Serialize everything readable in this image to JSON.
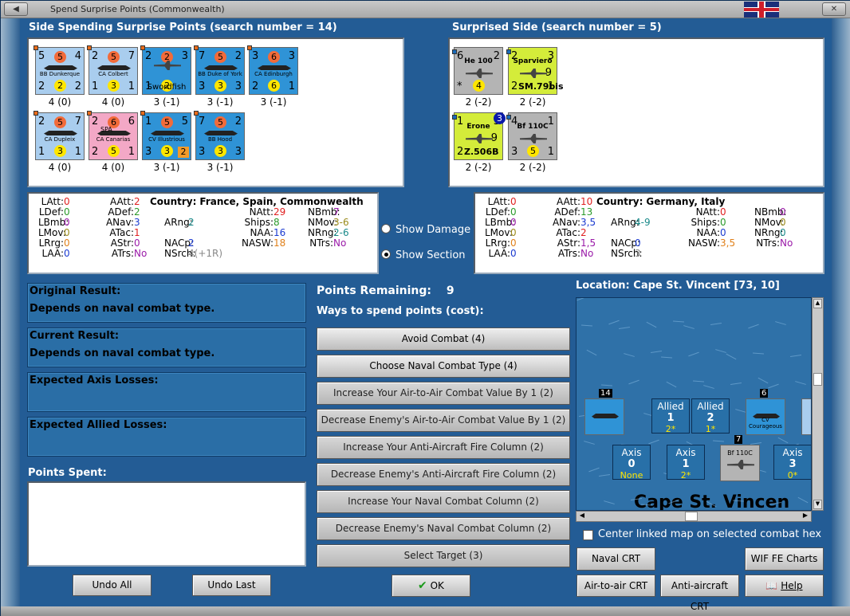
{
  "window": {
    "title": "Spend Surprise Points (Commonwealth)"
  },
  "spending": {
    "header": "Side Spending Surprise Points (search number = 14)",
    "units": [
      {
        "name": "BB Dunkerque",
        "tl": "5",
        "red": "5",
        "tr": "4",
        "bl": "2",
        "yel": "2",
        "br": "2",
        "cap": "4 (0)",
        "color": "#a9cdee",
        "kind": "ship"
      },
      {
        "name": "CA Colbert",
        "tl": "2",
        "red": "5",
        "tr": "7",
        "bl": "1",
        "yel": "3",
        "br": "1",
        "cap": "4 (0)",
        "color": "#a9cdee",
        "kind": "ship"
      },
      {
        "name": "Swordfish",
        "tl": "2",
        "red": "2",
        "tr": "3",
        "bl": "1",
        "yel": "2",
        "br": "",
        "cap": "3 (-1)",
        "color": "#2f93d6",
        "kind": "plane"
      },
      {
        "name": "BB Duke of York",
        "tl": "7",
        "red": "5",
        "tr": "2",
        "bl": "3",
        "yel": "3",
        "br": "3",
        "cap": "3 (-1)",
        "color": "#2f93d6",
        "kind": "ship"
      },
      {
        "name": "CA Edinburgh",
        "tl": "3",
        "red": "6",
        "tr": "3",
        "bl": "2",
        "yel": "6",
        "br": "1",
        "cap": "3 (-1)",
        "color": "#2f93d6",
        "kind": "ship"
      },
      {
        "name": "CA Dupleix",
        "tl": "2",
        "red": "5",
        "tr": "7",
        "bl": "1",
        "yel": "3",
        "br": "1",
        "cap": "4 (0)",
        "color": "#a9cdee",
        "kind": "ship"
      },
      {
        "name": "CA Canarias",
        "tl": "2",
        "red": "6",
        "tr": "6",
        "bl": "2",
        "yel": "5",
        "br": "1",
        "cap": "4 (0)",
        "color": "#f3a8c6",
        "kind": "ship"
      },
      {
        "name": "CV Illustrious",
        "tl": "1",
        "red": "5",
        "tr": "5",
        "bl": "3",
        "yel": "3",
        "br": "2",
        "cap": "3 (-1)",
        "color": "#2f93d6",
        "kind": "ship"
      },
      {
        "name": "BB Hood",
        "tl": "7",
        "red": "5",
        "tr": "2",
        "bl": "3",
        "yel": "3",
        "br": "3",
        "cap": "3 (-1)",
        "color": "#2f93d6",
        "kind": "ship"
      }
    ],
    "spa_label": "SPA"
  },
  "surprised": {
    "header": "Surprised Side (search number = 5)",
    "units": [
      {
        "name": "He 100",
        "tl": "6",
        "tr": "2",
        "bl": "*",
        "yel": "4",
        "br": "",
        "cap": "2 (-2)",
        "color": "#b4b4b4"
      },
      {
        "name": "Sparviero",
        "tl": "2",
        "tr": "3",
        "bl": "2",
        "yel": "",
        "br": "1",
        "extra": "9",
        "sub": "SM.79bis",
        "cap": "2 (-2)",
        "color": "#d4ec3a"
      },
      {
        "name": "Erone",
        "tl": "1",
        "tr": "3",
        "bl": "2",
        "yel": "",
        "br": "",
        "extra": "9",
        "sub": "Z.506B",
        "cap": "2 (-2)",
        "color": "#d4ec3a"
      },
      {
        "name": "Bf 110C",
        "tl": "4",
        "tr": "1",
        "bl": "3",
        "yel": "5",
        "br": "1",
        "cap": "2 (-2)",
        "color": "#b4b4b4"
      }
    ]
  },
  "stats_left": {
    "country_label": "Country:",
    "country": "France, Spain, Commonwealth",
    "LAtt": "0",
    "LDef": "0",
    "LBmb": "0",
    "LMov": "0",
    "LRrg": "0",
    "LAA": "0",
    "AAtt": "2",
    "ADef": "2",
    "ANav": "3",
    "ATac": "1",
    "AStr": "0",
    "ATrs": "No",
    "ARng": "2",
    "NACp": "2",
    "NSrch": "4(+1R)",
    "NAtt": "29",
    "Ships": "8",
    "NAA": "16",
    "NASW": "18",
    "NBmb": "7",
    "NMov": "3-6",
    "NRng": "2-6",
    "NTrs": "No"
  },
  "stats_right": {
    "country_label": "Country:",
    "country": "Germany, Italy",
    "LAtt": "0",
    "LDef": "0",
    "LBmb": "0",
    "LMov": "0",
    "LRrg": "0",
    "LAA": "0",
    "AAtt": "10",
    "ADef": "13",
    "ANav": "3,5",
    "ATac": "2",
    "AStr": "1,5",
    "ATrs": "No",
    "ARng": "4-9",
    "NACp": "0",
    "NSrch": "3",
    "NAtt": "0",
    "Ships": "0",
    "NAA": "0",
    "NASW": "3,5",
    "NBmb": "0",
    "NMov": "0",
    "NRng": "0",
    "NTrs": "No"
  },
  "options": {
    "show_damage": "Show Damage",
    "show_section": "Show Section"
  },
  "results": {
    "original_label": "Original Result:",
    "original_value": "Depends on naval combat type.",
    "current_label": "Current Result:",
    "current_value": "Depends on naval combat type.",
    "axis_losses": "Expected Axis Losses:",
    "allied_losses": "Expected Allied Losses:",
    "points_spent": "Points Spent:"
  },
  "points": {
    "label": "Points Remaining:",
    "value": "9",
    "ways": "Ways to spend points (cost):"
  },
  "actions": [
    "Avoid Combat (4)",
    "Choose Naval Combat Type (4)",
    "Increase Your Air-to-Air Combat Value By 1 (2)",
    "Decrease Enemy's Air-to-Air Combat Value By 1 (2)",
    "Increase Your Anti-Aircraft Fire Column (2)",
    "Decrease Enemy's Anti-Aircraft Fire Column (2)",
    "Increase Your Naval Combat Column (2)",
    "Decrease Enemy's Naval Combat Column (2)",
    "Select Target (3)"
  ],
  "buttons": {
    "undo_all": "Undo All",
    "undo_last": "Undo Last",
    "ok": "OK",
    "naval_crt": "Naval CRT",
    "wif_charts": "WIF FE Charts",
    "air_crt": "Air-to-air CRT",
    "aa_crt": "Anti-aircraft CRT",
    "help": "Help"
  },
  "map": {
    "location": "Location: Cape St. Vincent [73, 10]",
    "label": "Cape St. Vincen",
    "center_link": "Center linked map on selected combat hex",
    "boxes": [
      {
        "t": "Allied",
        "n": "1",
        "s": "2*"
      },
      {
        "t": "Allied",
        "n": "2",
        "s": "1*"
      },
      {
        "t": "Axis",
        "n": "0",
        "s": "None"
      },
      {
        "t": "Axis",
        "n": "1",
        "s": "2*"
      },
      {
        "t": "Axis",
        "n": "3",
        "s": "0*"
      }
    ],
    "stack_counts": [
      "14",
      "6",
      "7"
    ],
    "cv_name": "CV Courageous",
    "bf_name": "Bf 110C"
  }
}
